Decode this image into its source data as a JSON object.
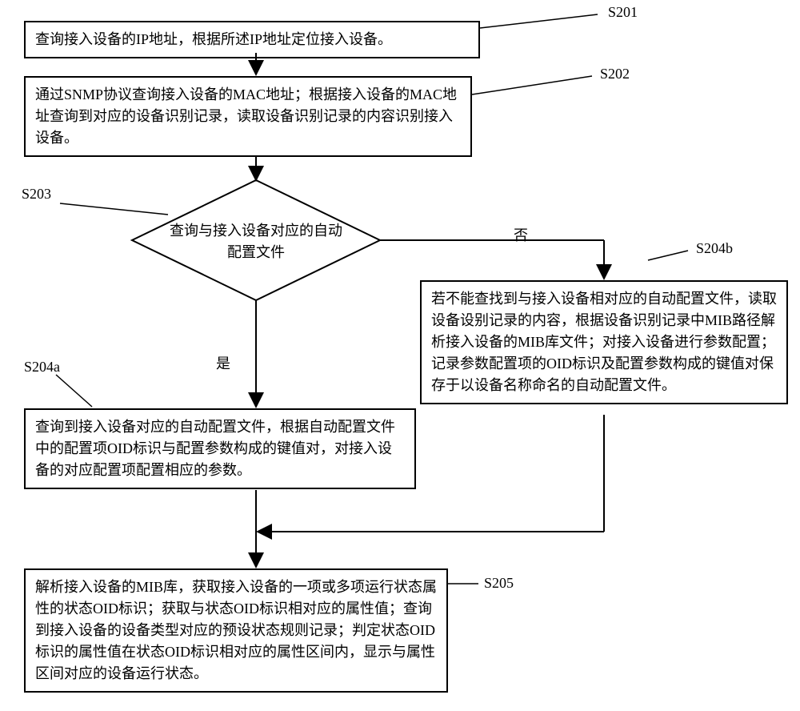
{
  "labels": {
    "s201": "S201",
    "s202": "S202",
    "s203": "S203",
    "s204a": "S204a",
    "s204b": "S204b",
    "s205": "S205"
  },
  "nodes": {
    "s201_text": "查询接入设备的IP地址，根据所述IP地址定位接入设备。",
    "s202_text": "通过SNMP协议查询接入设备的MAC地址；根据接入设备的MAC地址查询到对应的设备识别记录，读取设备识别记录的内容识别接入设备。",
    "s203_text_line1": "查询与接入设备对应的自动",
    "s203_text_line2": "配置文件",
    "s204a_text": "查询到接入设备对应的自动配置文件，根据自动配置文件中的配置项OID标识与配置参数构成的键值对，对接入设备的对应配置项配置相应的参数。",
    "s204b_text": "若不能查找到与接入设备相对应的自动配置文件，读取设备设别记录的内容，根据设备识别记录中MIB路径解析接入设备的MIB库文件；对接入设备进行参数配置；记录参数配置项的OID标识及配置参数构成的键值对保存于以设备名称命名的自动配置文件。",
    "s205_text": "解析接入设备的MIB库，获取接入设备的一项或多项运行状态属性的状态OID标识；获取与状态OID标识相对应的属性值；查询到接入设备的设备类型对应的预设状态规则记录；判定状态OID标识的属性值在状态OID标识相对应的属性区间内，显示与属性区间对应的设备运行状态。"
  },
  "edges": {
    "yes": "是",
    "no": "否"
  }
}
